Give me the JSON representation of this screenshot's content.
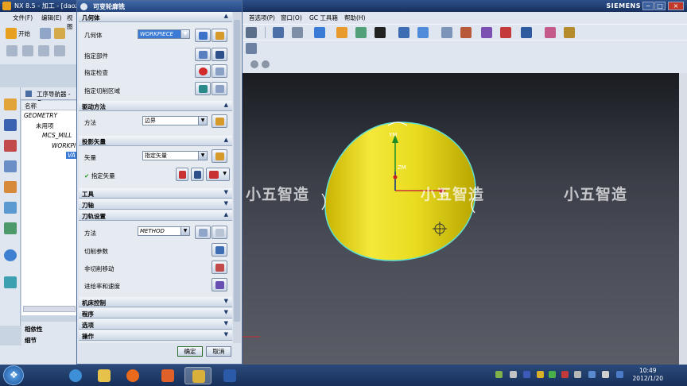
{
  "window": {
    "title": "NX 8.5 - 加工 - [daozh",
    "brand": "SIEMENS",
    "controls": [
      "−",
      "□",
      "×"
    ]
  },
  "leftmenu": [
    "文件(F)",
    "编辑(E)",
    "视图"
  ],
  "start_label": "开始",
  "menu": [
    "首选项(P)",
    "窗口(O)",
    "GC 工具箱",
    "帮助(H)"
  ],
  "dialog": {
    "title": "可变轮廓铣",
    "geometry": {
      "header": "几何体",
      "label": "几何体",
      "value": "WORKPIECE",
      "part": "指定部件",
      "check": "指定检查",
      "cut_area": "指定切削区域"
    },
    "drive": {
      "header": "驱动方法",
      "label": "方法",
      "value": "边界"
    },
    "projection": {
      "header": "投影矢量",
      "label": "矢量",
      "value": "指定矢量",
      "specify": "指定矢量"
    },
    "tool_header": "工具",
    "axis_header": "刀轴",
    "path": {
      "header": "刀轨设置",
      "method_label": "方法",
      "method_value": "METHOD",
      "cut_params": "切削参数",
      "non_cut": "非切削移动",
      "feeds": "进给率和速度"
    },
    "machine_header": "机床控制",
    "program_header": "程序",
    "options_header": "选项",
    "actions_header": "操作",
    "ok": "确定",
    "cancel": "取消"
  },
  "navigator": {
    "title": "工序导航器 - 几",
    "column": "名称",
    "rows": [
      "GEOMETRY",
      "未用项",
      "MCS_MILL",
      "WORKPI",
      "VA"
    ],
    "bottom": [
      "相依性",
      "细节"
    ]
  },
  "viewport": {
    "watermark": "小五智造",
    "axes": {
      "ym": "YM",
      "zm": "ZM",
      "xm": "XM"
    }
  },
  "clock": {
    "time": "10:49",
    "date": "2012/1/20"
  }
}
